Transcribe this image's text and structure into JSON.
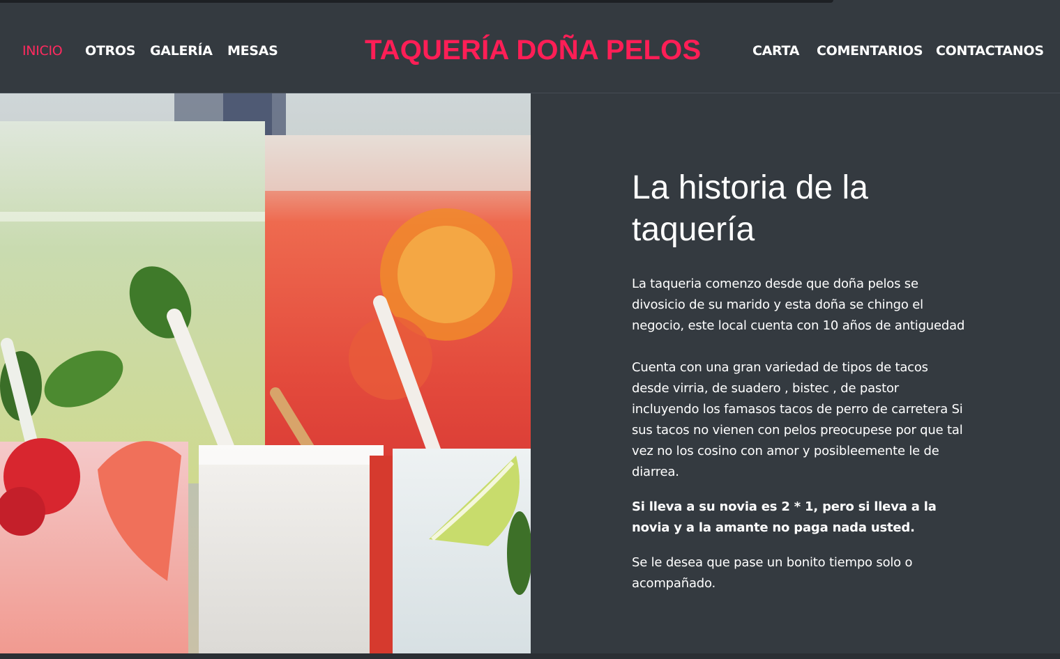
{
  "nav": {
    "left": [
      {
        "label": "INICIO",
        "active": true
      },
      {
        "label": "OTROS"
      },
      {
        "label": "GALERÍA"
      },
      {
        "label": "MESAS"
      }
    ],
    "brand": "TAQUERÍA DOÑA PELOS",
    "right": [
      {
        "label": "CARTA"
      },
      {
        "label": "COMENTARIOS"
      },
      {
        "label": "CONTACTANOS"
      }
    ]
  },
  "hero": {
    "image": "drinks-photo"
  },
  "content": {
    "heading": "La historia de la taquería",
    "paragraph1": "La taqueria comenzo desde que doña pelos se divosicio de su marido y esta doña se chingo el negocio, este local cuenta con 10 años de antiguedad",
    "paragraph2": "Cuenta con una gran variedad de tipos de tacos desde virria, de suadero , bistec , de pastor incluyendo los famasos tacos de perro de carretera Si sus tacos no vienen con pelos preocupese por que tal vez no los cosino con amor y posibleemente le de diarrea.",
    "paragraph3": "Si lleva a su novia es 2 * 1, pero si lleva a la novia y a la amante no paga nada usted.",
    "paragraph4": "Se le desea que pase un bonito tiempo solo o acompañado."
  },
  "colors": {
    "background": "#343a40",
    "accent": "#ff1e56",
    "text": "#ffffff"
  }
}
